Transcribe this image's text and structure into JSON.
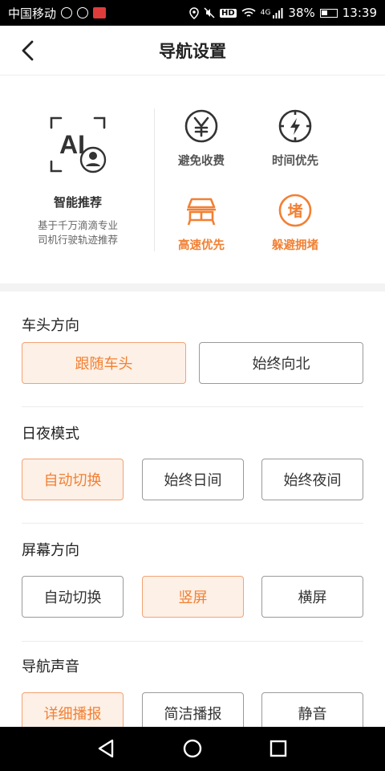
{
  "status_bar": {
    "carrier": "中国移动",
    "network_badge": "HD",
    "network_type": "4G",
    "battery_percent": "38%",
    "time": "13:39"
  },
  "header": {
    "title": "导航设置"
  },
  "ai_recommend": {
    "icon_text": "AI",
    "title": "智能推荐",
    "desc_line1": "基于千万滴滴专业",
    "desc_line2": "司机行驶轨迹推荐"
  },
  "route_prefs": [
    {
      "label": "避免收费",
      "active": false
    },
    {
      "label": "时间优先",
      "active": false
    },
    {
      "label": "高速优先",
      "active": true
    },
    {
      "label": "躲避拥堵",
      "active": true,
      "icon_text": "堵"
    }
  ],
  "sections": {
    "heading": {
      "title": "车头方向",
      "options": [
        "跟随车头",
        "始终向北"
      ],
      "selected": "跟随车头"
    },
    "day_night": {
      "title": "日夜模式",
      "options": [
        "自动切换",
        "始终日间",
        "始终夜间"
      ],
      "selected": "自动切换"
    },
    "orientation": {
      "title": "屏幕方向",
      "options": [
        "自动切换",
        "竖屏",
        "横屏"
      ],
      "selected": "竖屏"
    },
    "voice": {
      "title": "导航声音",
      "options": [
        "详细播报",
        "简洁播报",
        "静音"
      ],
      "selected": "详细播报"
    }
  },
  "colors": {
    "accent": "#f28033",
    "selected_bg": "#fdf0e6",
    "selected_border": "#f2a374",
    "icon_gray": "#333333"
  }
}
